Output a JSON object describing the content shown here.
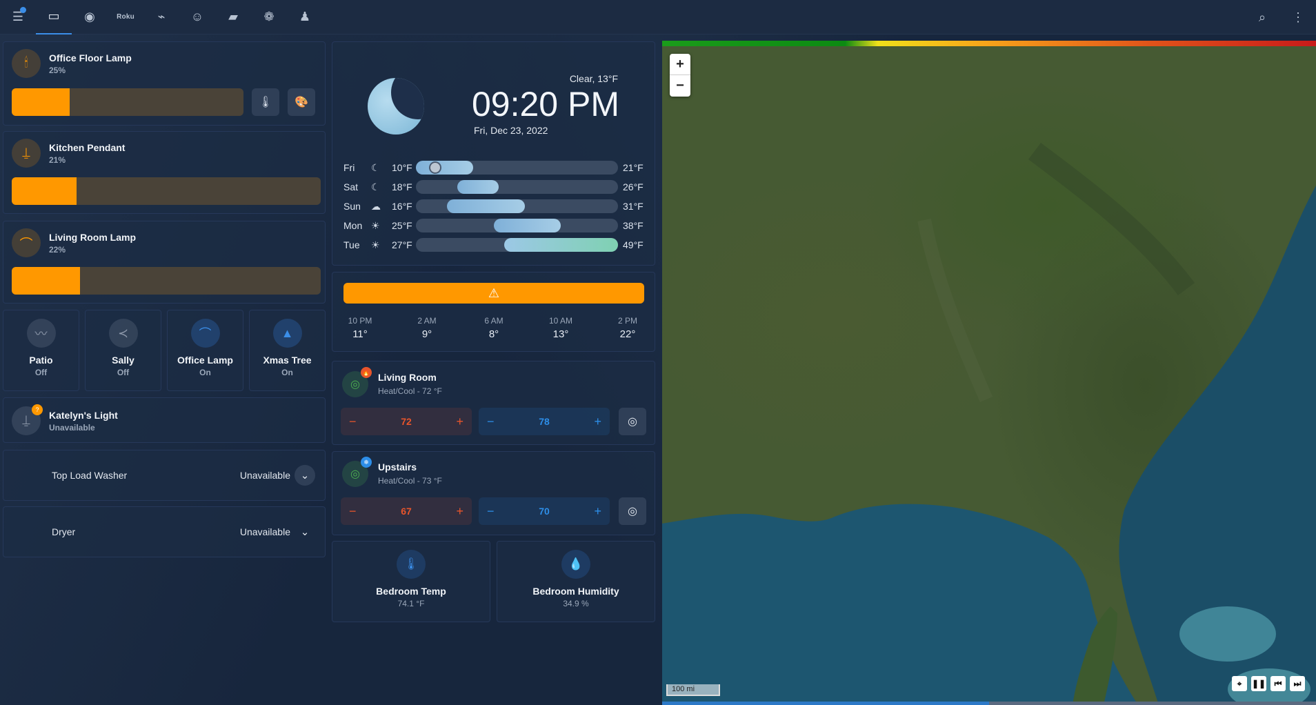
{
  "topbar": {
    "tabs": [
      {
        "name": "menu-icon",
        "glyph": "☰"
      },
      {
        "name": "monitor-icon",
        "glyph": "🖥"
      },
      {
        "name": "spotify-icon",
        "glyph": "◉"
      },
      {
        "name": "roku-label",
        "glyph": "Roku"
      },
      {
        "name": "camera-icon",
        "glyph": "⌁"
      },
      {
        "name": "robot-icon",
        "glyph": "☺"
      },
      {
        "name": "car-icon",
        "glyph": "🚙"
      },
      {
        "name": "raspberry-icon",
        "glyph": "❁"
      },
      {
        "name": "person-icon",
        "glyph": "♟"
      }
    ],
    "search_glyph": "🔍",
    "more_glyph": "⋮"
  },
  "lights": [
    {
      "name": "Office Floor Lamp",
      "level": "25%",
      "fill_fraction": 0.25
    },
    {
      "name": "Kitchen Pendant",
      "level": "21%",
      "fill_fraction": 0.21
    },
    {
      "name": "Living Room Lamp",
      "level": "22%",
      "fill_fraction": 0.22
    }
  ],
  "tiles": [
    {
      "name": "Patio",
      "state": "Off"
    },
    {
      "name": "Sally",
      "state": "Off"
    },
    {
      "name": "Office Lamp",
      "state": "On"
    },
    {
      "name": "Xmas Tree",
      "state": "On"
    }
  ],
  "katelyn": {
    "name": "Katelyn's Light",
    "state": "Unavailable",
    "badge": "?"
  },
  "washer": {
    "label": "Top Load Washer",
    "value": "Unavailable"
  },
  "dryer": {
    "label": "Dryer",
    "value": "Unavailable"
  },
  "weather": {
    "condition": "Clear, 13°F",
    "time": "09:20 PM",
    "date": "Fri, Dec 23, 2022",
    "forecast": [
      {
        "day": "Fri",
        "low": "10°F",
        "high": "21°F",
        "lo": 10,
        "hi": 21
      },
      {
        "day": "Sat",
        "low": "18°F",
        "high": "26°F",
        "lo": 18,
        "hi": 26
      },
      {
        "day": "Sun",
        "low": "16°F",
        "high": "31°F",
        "lo": 16,
        "hi": 31
      },
      {
        "day": "Mon",
        "low": "25°F",
        "high": "38°F",
        "lo": 25,
        "hi": 38
      },
      {
        "day": "Tue",
        "low": "27°F",
        "high": "49°F",
        "lo": 27,
        "hi": 49
      }
    ],
    "hourly": [
      {
        "time": "10 PM",
        "temp": "11°"
      },
      {
        "time": "2 AM",
        "temp": "9°"
      },
      {
        "time": "6 AM",
        "temp": "8°"
      },
      {
        "time": "10 AM",
        "temp": "13°"
      },
      {
        "time": "2 PM",
        "temp": "22°"
      }
    ]
  },
  "thermostats": [
    {
      "name": "Living Room",
      "mode": "Heat/Cool - 72 °F",
      "low": "72",
      "high": "78",
      "badge": "🔥",
      "badge_color": "#e8552b"
    },
    {
      "name": "Upstairs",
      "mode": "Heat/Cool - 73 °F",
      "low": "67",
      "high": "70",
      "badge": "❄",
      "badge_color": "#2d8ee8"
    }
  ],
  "sensors": [
    {
      "name": "Bedroom Temp",
      "value": "74.1 °F"
    },
    {
      "name": "Bedroom Humidity",
      "value": "34.9 %"
    }
  ],
  "map": {
    "zoom_in": "+",
    "zoom_out": "−",
    "scale": "100 mi",
    "progress_fraction": 0.5
  },
  "colors": {
    "accent": "#ff9800",
    "blue": "#3b8ee8",
    "heat": "#e8552b",
    "cool": "#2d8ee8"
  }
}
